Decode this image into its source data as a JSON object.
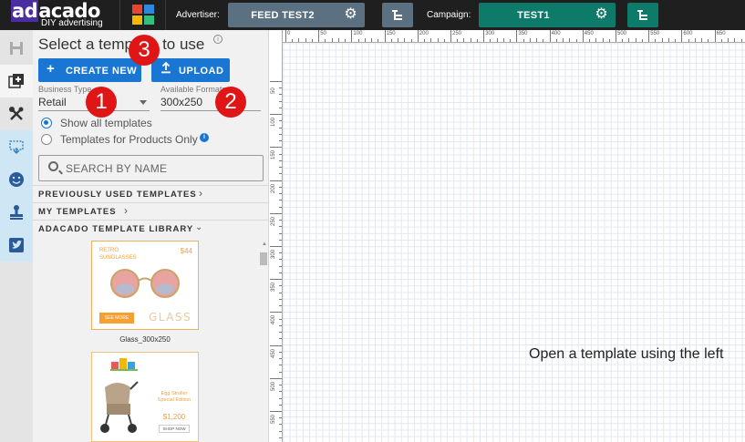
{
  "topbar": {
    "logo_text": "adacado",
    "logo_tagline": "DIY advertising",
    "advertiser_label": "Advertiser:",
    "advertiser_value": "FEED TEST2",
    "campaign_label": "Campaign:",
    "campaign_value": "TEST1",
    "colors": {
      "bar": "#1f1f1f",
      "advertiser": "#5b7080",
      "campaign": "#0d7a6a"
    }
  },
  "rail": {
    "items": [
      {
        "icon": "save-icon",
        "glyph": "💾"
      },
      {
        "icon": "add-layer-icon",
        "glyph": "⊞"
      },
      {
        "icon": "tools-icon",
        "glyph": "✕"
      },
      {
        "icon": "dropzone-icon",
        "glyph": "⬚"
      },
      {
        "icon": "smiley-icon",
        "glyph": "☻"
      },
      {
        "icon": "stamp-icon",
        "glyph": "⚲"
      },
      {
        "icon": "twitter-icon",
        "glyph": "🐦"
      }
    ]
  },
  "panel": {
    "title": "Select a template to use",
    "create_new_label": "CREATE NEW",
    "upload_label": "UPLOAD",
    "business_type_label": "Business Type",
    "business_type_value": "Retail",
    "available_formats_label": "Available Formats",
    "available_formats_value": "300x250",
    "radio_all": "Show all templates",
    "radio_products": "Templates for Products Only",
    "search_placeholder": "SEARCH BY NAME",
    "sections": {
      "previously_used": "PREVIOUSLY USED TEMPLATES",
      "my_templates": "MY TEMPLATES",
      "library": "ADACADO TEMPLATE LIBRARY"
    },
    "templates": [
      {
        "name": "Glass_300x250",
        "headline": "RETRO SUNGLASSES",
        "price": "$44",
        "cta": "SEE MORE",
        "brand": "GLASS"
      },
      {
        "name": "",
        "headline": "Egg Stroller Special Edition",
        "price": "$1,200",
        "cta": "SHOP NOW"
      }
    ]
  },
  "badges": [
    "1",
    "2",
    "3"
  ],
  "canvas": {
    "ruler_top": [
      "0",
      "50",
      "100",
      "150",
      "200",
      "250",
      "300",
      "350",
      "400",
      "450",
      "500",
      "550",
      "600",
      "650"
    ],
    "ruler_left": [
      "50",
      "100",
      "150",
      "200",
      "250",
      "300",
      "350",
      "400",
      "450",
      "500",
      "550"
    ],
    "message": "Open a template using the left"
  }
}
